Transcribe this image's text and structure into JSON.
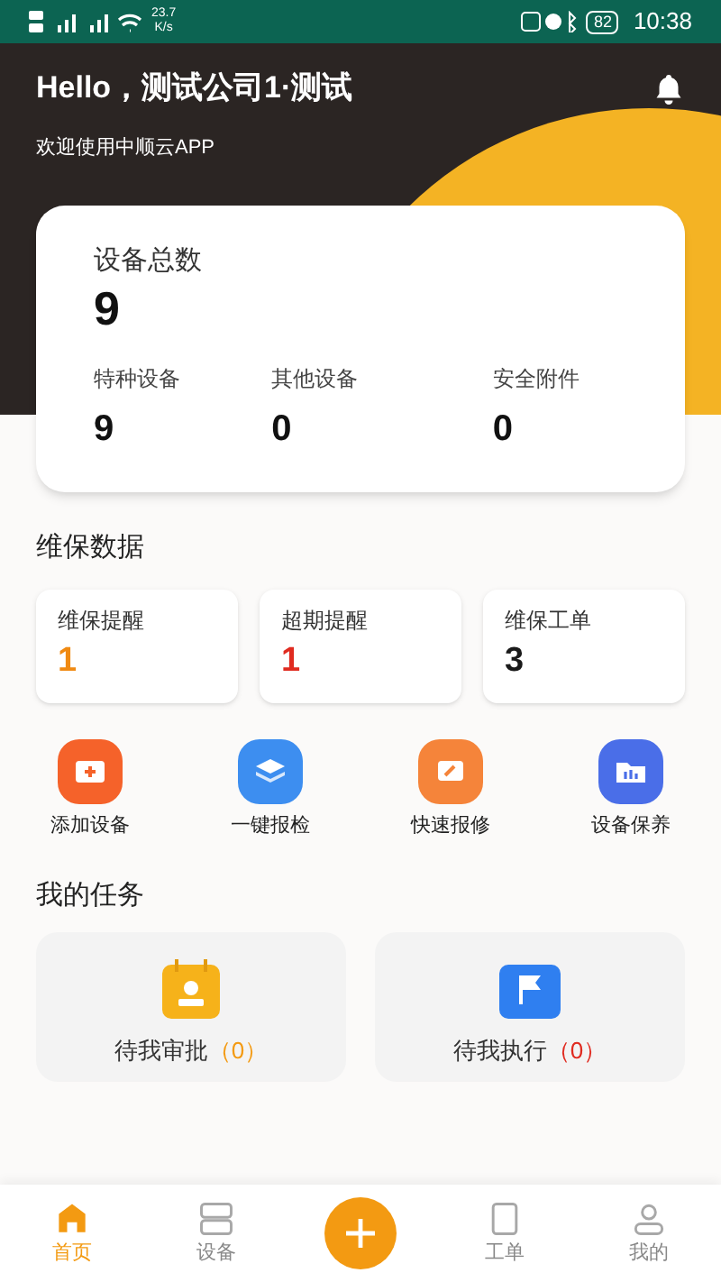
{
  "status_bar": {
    "speed": "23.7\nK/s",
    "battery": "82",
    "time": "10:38"
  },
  "header": {
    "greeting": "Hello，测试公司1·测试",
    "subtitle": "欢迎使用中顺云APP"
  },
  "device_card": {
    "total_label": "设备总数",
    "total": "9",
    "stats": [
      {
        "label": "特种设备",
        "value": "9"
      },
      {
        "label": "其他设备",
        "value": "0"
      },
      {
        "label": "安全附件",
        "value": "0"
      }
    ]
  },
  "maintenance": {
    "title": "维保数据",
    "items": [
      {
        "label": "维保提醒",
        "value": "1",
        "color": "#f08a12"
      },
      {
        "label": "超期提醒",
        "value": "1",
        "color": "#e02b20"
      },
      {
        "label": "维保工单",
        "value": "3",
        "color": "#1a1a1a"
      }
    ]
  },
  "actions": [
    {
      "label": "添加设备",
      "kind": "add"
    },
    {
      "label": "一键报检",
      "kind": "layers"
    },
    {
      "label": "快速报修",
      "kind": "repair"
    },
    {
      "label": "设备保养",
      "kind": "folder"
    }
  ],
  "tasks": {
    "title": "我的任务",
    "items": [
      {
        "label": "待我审批",
        "count": "（0）",
        "kind": "approve"
      },
      {
        "label": "待我执行",
        "count": "（0）",
        "kind": "execute"
      }
    ]
  },
  "nav": [
    {
      "label": "首页",
      "kind": "home",
      "selected": true
    },
    {
      "label": "设备",
      "kind": "device",
      "selected": false
    },
    {
      "kind": "plus",
      "selected": false
    },
    {
      "label": "工单",
      "kind": "order",
      "selected": false
    },
    {
      "label": "我的",
      "kind": "user",
      "selected": false
    }
  ]
}
